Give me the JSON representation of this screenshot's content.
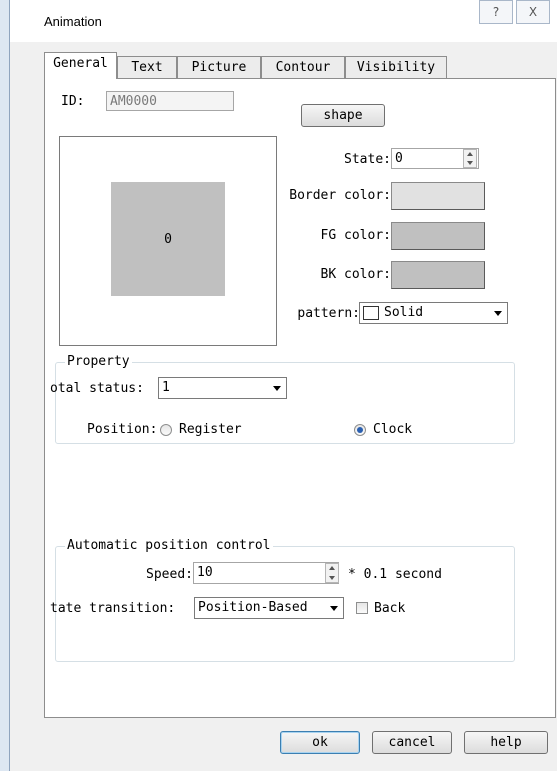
{
  "window": {
    "title": "Animation",
    "help_glyph": "?",
    "close_glyph": "X"
  },
  "tabs": [
    {
      "label": "General"
    },
    {
      "label": "Text"
    },
    {
      "label": "Picture"
    },
    {
      "label": "Contour"
    },
    {
      "label": "Visibility"
    }
  ],
  "general": {
    "id_label": "ID:",
    "id_value": "AM0000",
    "shape_button": "shape",
    "preview_value": "0",
    "state_label": "State:",
    "state_value": "0",
    "border_color_label": "Border color:",
    "fg_color_label": "FG color:",
    "bk_color_label": "BK color:",
    "pattern_label": "pattern:",
    "pattern_value": "Solid",
    "colors": {
      "border": "#e1e1e1",
      "fg": "#c0c0c0",
      "bk": "#c0c0c0",
      "preview_fill": "#c0c0c0"
    }
  },
  "property": {
    "legend": "Property",
    "total_status_label": "otal status:",
    "total_status_value": "1",
    "position_label": "Position:",
    "register_label": "Register",
    "clock_label": "Clock",
    "position_selected": "Clock"
  },
  "auto_position": {
    "legend": "Automatic position control",
    "speed_label": "Speed:",
    "speed_value": "10",
    "speed_unit": "* 0.1 second",
    "transition_label": "tate transition:",
    "transition_value": "Position-Based",
    "back_label": "Back",
    "back_checked": false
  },
  "footer": {
    "ok": "ok",
    "cancel": "cancel",
    "help": "help"
  }
}
